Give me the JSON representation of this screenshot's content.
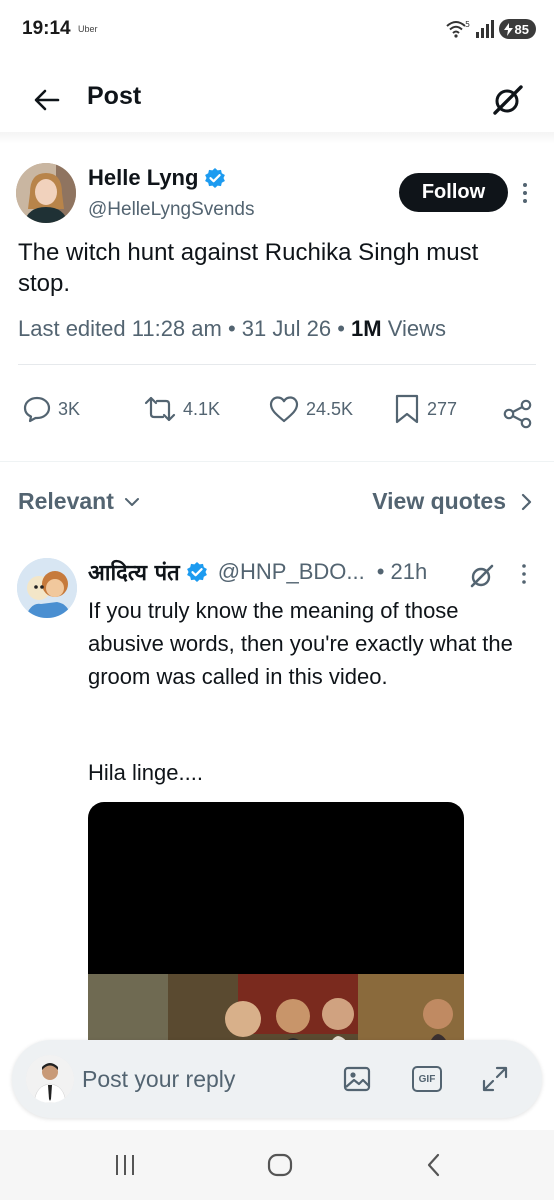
{
  "status_bar": {
    "time": "19:14",
    "app_indicator": "Uber",
    "battery": "85",
    "icons": [
      "wifi-icon",
      "signal-icon",
      "battery-charging-icon"
    ]
  },
  "header": {
    "title": "Post",
    "icons": [
      "back-arrow-icon",
      "grok-icon"
    ]
  },
  "post": {
    "author_name": "Helle Lyng",
    "author_handle": "@HelleLyngSvends",
    "verified": true,
    "follow_label": "Follow",
    "text": "The witch hunt against Ruchika Singh must stop.",
    "meta": {
      "prefix": "Last edited 11:28 am",
      "separator": " • ",
      "date": "31 Jul 26",
      "views_count": "1M",
      "views_label": " Views"
    },
    "actions": {
      "replies": "3K",
      "reposts": "4.1K",
      "likes": "24.5K",
      "bookmarks": "277"
    }
  },
  "sort": {
    "label": "Relevant",
    "view_quotes": "View quotes"
  },
  "reply": {
    "author_name": "आदित्य पंत",
    "author_handle": "@HNP_BDO...",
    "time": "• 21h",
    "verified": true,
    "text": "If you truly know the meaning of those abusive words, then you're exactly what the groom was called in this video.",
    "text2": "Hila linge...."
  },
  "composer": {
    "placeholder": "Post your reply",
    "icons": [
      "image-icon",
      "gif-icon",
      "expand-icon"
    ],
    "gif_label": "GIF"
  },
  "colors": {
    "text_primary": "#0f1419",
    "text_secondary": "#536471",
    "verified_blue": "#1d9bf0",
    "follow_bg": "#0f1419"
  }
}
